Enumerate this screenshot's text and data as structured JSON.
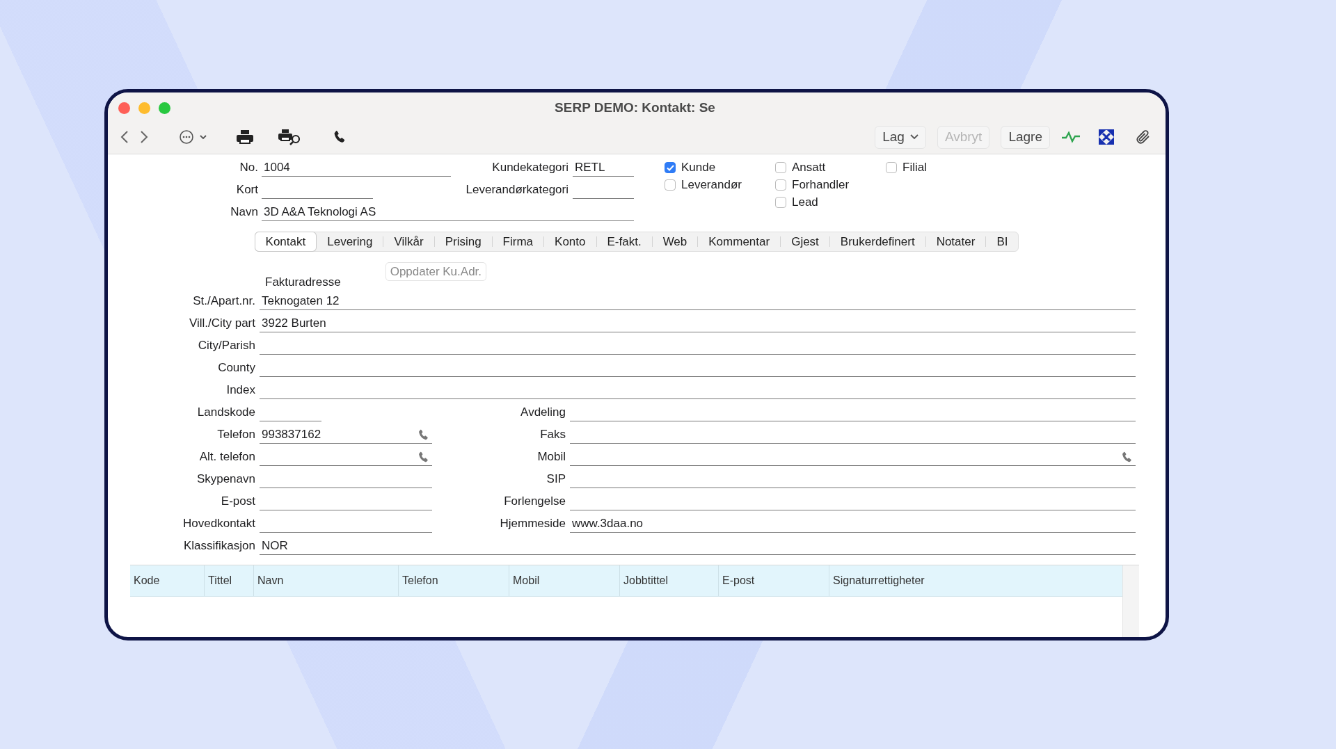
{
  "window": {
    "title": "SERP DEMO: Kontakt: Se"
  },
  "toolbar": {
    "buttons": [
      {
        "label": "Lag",
        "kind": "menu",
        "disabled": false
      },
      {
        "label": "Avbryt",
        "kind": "plain",
        "disabled": true
      },
      {
        "label": "Lagre",
        "kind": "plain",
        "disabled": false
      }
    ]
  },
  "header": {
    "number": {
      "label": "No.",
      "value": "1004"
    },
    "short": {
      "label": "Kort"
    },
    "name": {
      "label": "Navn",
      "value": "3D A&A Teknologi AS"
    },
    "customer_category": {
      "label": "Kundekategori",
      "value": "RETL"
    },
    "supplier_category": {
      "label": "Leverandørkategori"
    }
  },
  "roles": [
    [
      {
        "label": "Kunde",
        "checked": true
      },
      {
        "label": "Leverandør",
        "checked": false
      }
    ],
    [
      {
        "label": "Ansatt",
        "checked": false
      },
      {
        "label": "Forhandler",
        "checked": false
      },
      {
        "label": "Lead",
        "checked": false
      }
    ],
    [
      {
        "label": "Filial",
        "checked": false
      }
    ]
  ],
  "tabs": [
    {
      "label": "Kontakt",
      "selected": true
    },
    {
      "label": "Levering",
      "selected": false
    },
    {
      "label": "Vilkår",
      "selected": false
    },
    {
      "label": "Prising",
      "selected": false
    },
    {
      "label": "Firma",
      "selected": false
    },
    {
      "label": "Konto",
      "selected": false
    },
    {
      "label": "E-fakt.",
      "selected": false
    },
    {
      "label": "Web",
      "selected": false
    },
    {
      "label": "Kommentar",
      "selected": false
    },
    {
      "label": "Gjest",
      "selected": false
    },
    {
      "label": "Brukerdefinert",
      "selected": false
    },
    {
      "label": "Notater",
      "selected": false
    },
    {
      "label": "BI",
      "selected": false
    }
  ],
  "address": {
    "title": "Fakturadresse",
    "update_button": "Oppdater Ku.Adr.",
    "fields": [
      {
        "label": "St./Apart.nr.",
        "value": "Teknogaten 12"
      },
      {
        "label": "Vill./City part",
        "value": "3922 Burten"
      },
      {
        "label": "City/Parish"
      },
      {
        "label": "County"
      },
      {
        "label": "Index"
      }
    ]
  },
  "contact_rows": [
    {
      "kind": "pair",
      "left": {
        "label": "Landskode",
        "kind": "short"
      },
      "right": {
        "label": "Avdeling",
        "kind": "text"
      }
    },
    {
      "kind": "pair",
      "left": {
        "label": "Telefon",
        "value": "993837162",
        "kind": "phone"
      },
      "right": {
        "label": "Faks",
        "kind": "text"
      }
    },
    {
      "kind": "pair",
      "left": {
        "label": "Alt. telefon",
        "kind": "phone"
      },
      "right": {
        "label": "Mobil",
        "kind": "phone"
      }
    },
    {
      "kind": "pair",
      "left": {
        "label": "Skypenavn",
        "kind": "text"
      },
      "right": {
        "label": "SIP",
        "kind": "text"
      }
    },
    {
      "kind": "pair",
      "left": {
        "label": "E-post",
        "kind": "text"
      },
      "right": {
        "label": "Forlengelse",
        "kind": "text"
      }
    },
    {
      "kind": "pair",
      "left": {
        "label": "Hovedkontakt",
        "kind": "text"
      },
      "right": {
        "label": "Hjemmeside",
        "value": "www.3daa.no",
        "kind": "text"
      }
    },
    {
      "kind": "wide",
      "label": "Klassifikasjon",
      "value": "NOR"
    }
  ],
  "table": {
    "columns": [
      "Kode",
      "Tittel",
      "Navn",
      "Telefon",
      "Mobil",
      "Jobbtittel",
      "E-post",
      "Signaturrettigheter"
    ]
  }
}
